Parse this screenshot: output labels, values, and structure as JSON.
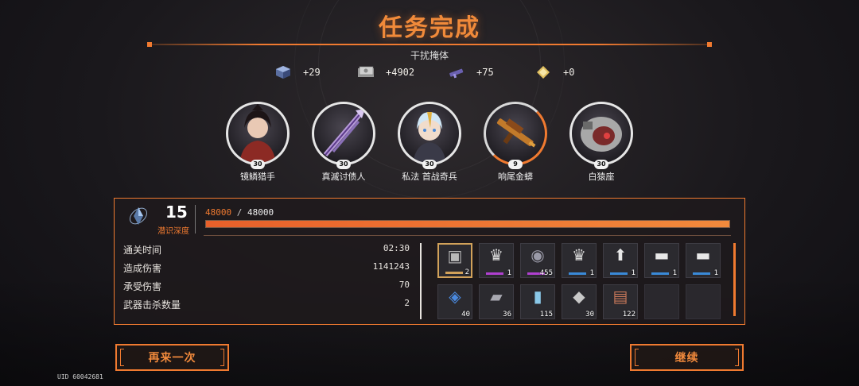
{
  "header": {
    "title": "任务完成",
    "subtitle": "干扰掩体"
  },
  "rewards": [
    {
      "icon": "cube-material-icon",
      "value": "+29"
    },
    {
      "icon": "currency-bills-icon",
      "value": "+4902"
    },
    {
      "icon": "gun-part-icon",
      "value": "+75"
    },
    {
      "icon": "gold-crystal-icon",
      "value": "+0"
    }
  ],
  "characters": [
    {
      "name": "镜鳞猎手",
      "level": "30"
    },
    {
      "name": "真滅讨债人",
      "level": "30"
    },
    {
      "name": "私法 首战奇兵",
      "level": "30"
    },
    {
      "name": "响尾金蟒",
      "level": "9"
    },
    {
      "name": "白猿座",
      "level": "30"
    }
  ],
  "depth": {
    "value": "15",
    "label": "潜识深度"
  },
  "xp": {
    "current": "48000",
    "separator": "/",
    "max": "48000",
    "progress": 1.0
  },
  "stats": [
    {
      "label": "通关时间",
      "value": "02:30"
    },
    {
      "label": "造成伤害",
      "value": "1141243"
    },
    {
      "label": "承受伤害",
      "value": "70"
    },
    {
      "label": "武器击杀数量",
      "value": "2"
    }
  ],
  "items": [
    {
      "icon": "armor-module-icon",
      "qty": "2",
      "rarity": "#d2a25a",
      "gold": true
    },
    {
      "icon": "rank-insignia-icon",
      "qty": "1",
      "rarity": "#b040d0"
    },
    {
      "icon": "grenade-icon",
      "qty": "455",
      "rarity": "#b040d0"
    },
    {
      "icon": "rank-insignia-icon",
      "qty": "1",
      "rarity": "#3a8ad8"
    },
    {
      "icon": "rocket-icon",
      "qty": "1",
      "rarity": "#3a8ad8"
    },
    {
      "icon": "rifle-icon",
      "qty": "1",
      "rarity": "#3a8ad8"
    },
    {
      "icon": "rifle-icon",
      "qty": "1",
      "rarity": "#3a8ad8"
    },
    {
      "icon": "blue-core-icon",
      "qty": "40",
      "rarity": ""
    },
    {
      "icon": "metal-plate-icon",
      "qty": "36",
      "rarity": ""
    },
    {
      "icon": "canister-icon",
      "qty": "115",
      "rarity": ""
    },
    {
      "icon": "steel-sheet-icon",
      "qty": "30",
      "rarity": ""
    },
    {
      "icon": "card-pack-icon",
      "qty": "122",
      "rarity": ""
    },
    {
      "icon": "",
      "qty": "",
      "rarity": ""
    },
    {
      "icon": "",
      "qty": "",
      "rarity": ""
    }
  ],
  "buttons": {
    "retry": "再来一次",
    "continue": "继续"
  },
  "uid": "UID 60042681",
  "colors": {
    "accent": "#f07a30",
    "background": "#1a181c"
  }
}
